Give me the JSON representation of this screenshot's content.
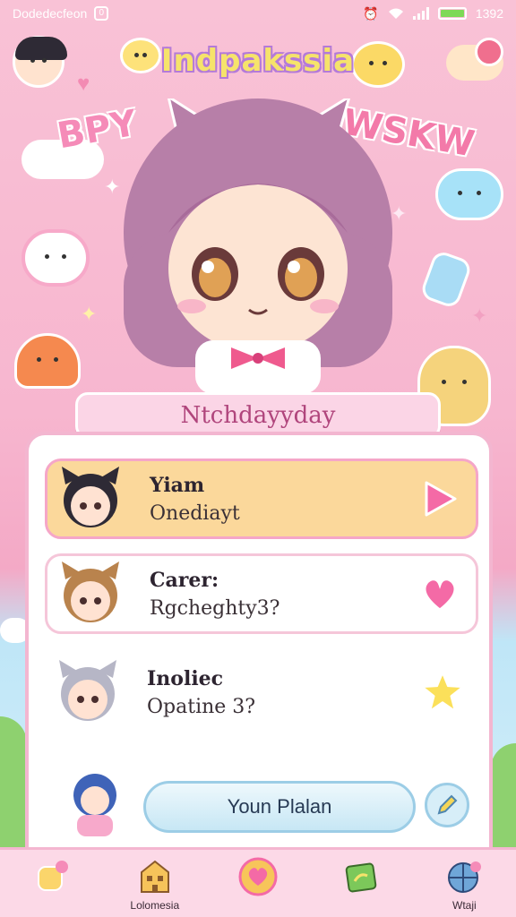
{
  "status_bar": {
    "carrier": "Dodedecfeon",
    "sim": "0",
    "time": "1392",
    "battery_level": 1.0
  },
  "header": {
    "app_title": "Indpakssia",
    "deco_left": "BPY",
    "deco_right": "WSKW"
  },
  "banner": {
    "label": "Ntchdayyday"
  },
  "list": {
    "items": [
      {
        "title": "Yiam",
        "subtitle": "Onediayt",
        "action_icon": "play-icon",
        "state": "selected",
        "avatar_hair": "#2e2a35",
        "avatar_skin": "#ffe2d2"
      },
      {
        "title": "Carer:",
        "subtitle": "Rgcheghty3?",
        "action_icon": "heart-icon",
        "state": "plain",
        "avatar_hair": "#b9834d",
        "avatar_skin": "#ffe2d2"
      },
      {
        "title": "Inoliec",
        "subtitle": "Opatine 3?",
        "action_icon": "star-icon",
        "state": "bare",
        "avatar_hair": "#b6b6c6",
        "avatar_skin": "#ffe2d2"
      }
    ]
  },
  "cta": {
    "label": "Youn Plalan",
    "side_icon": "pencil-icon"
  },
  "bottom_nav": {
    "items": [
      {
        "icon": "cup-icon",
        "label": ""
      },
      {
        "icon": "building-icon",
        "label": "Lolomesia"
      },
      {
        "icon": "heart-circle-icon",
        "label": ""
      },
      {
        "icon": "map-icon",
        "label": ""
      },
      {
        "icon": "globe-icon",
        "label": "Wtaji"
      }
    ]
  },
  "colors": {
    "accent_pink": "#f58bb8",
    "title_yellow": "#f6e36b",
    "panel_border": "#f3b6d0",
    "selected_bg": "#fbd89b"
  }
}
